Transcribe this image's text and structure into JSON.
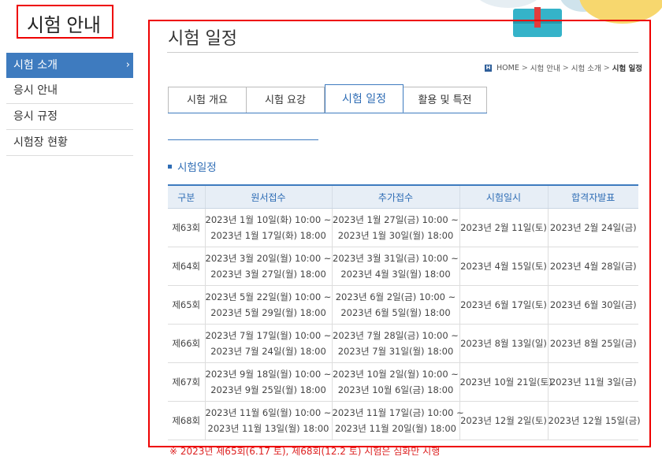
{
  "sidebar": {
    "title": "시험 안내",
    "items": [
      {
        "label": "시험 소개",
        "chevron": "›"
      },
      {
        "label": "응시 안내"
      },
      {
        "label": "응시 규정"
      },
      {
        "label": "시험장 현황"
      }
    ]
  },
  "page": {
    "title": "시험 일정",
    "breadcrumb": {
      "home_icon": "H",
      "items": [
        "HOME",
        "시험 안내",
        "시험 소개"
      ],
      "separator": ">",
      "current": "시험 일정"
    }
  },
  "tabs": [
    {
      "label": "시험 개요"
    },
    {
      "label": "시험 요강"
    },
    {
      "label": "시험 일정"
    },
    {
      "label": "활용 및 특전"
    }
  ],
  "section": {
    "title": "시험일정"
  },
  "schedule": {
    "headers": [
      "구분",
      "원서접수",
      "추가접수",
      "시험일시",
      "합격자발표"
    ],
    "rows": [
      {
        "round": "제63회",
        "apply": [
          "2023년 1월 10일(화) 10:00 ~",
          "2023년 1월 17일(화) 18:00"
        ],
        "extra": [
          "2023년 1월 27일(금) 10:00 ~",
          "2023년 1월 30일(월) 18:00"
        ],
        "exam": "2023년 2월 11일(토)",
        "result": "2023년 2월 24일(금)"
      },
      {
        "round": "제64회",
        "apply": [
          "2023년 3월 20일(월) 10:00 ~",
          "2023년 3월 27일(월) 18:00"
        ],
        "extra": [
          "2023년 3월 31일(금) 10:00 ~",
          "2023년 4월 3일(월) 18:00"
        ],
        "exam": "2023년 4월 15일(토)",
        "result": "2023년 4월 28일(금)"
      },
      {
        "round": "제65회",
        "apply": [
          "2023년 5월 22일(월) 10:00 ~",
          "2023년 5월 29일(월) 18:00"
        ],
        "extra": [
          "2023년 6월 2일(금) 10:00 ~",
          "2023년 6월 5일(월) 18:00"
        ],
        "exam": "2023년 6월 17일(토)",
        "result": "2023년 6월 30일(금)"
      },
      {
        "round": "제66회",
        "apply": [
          "2023년 7월 17일(월) 10:00 ~",
          "2023년 7월 24일(월) 18:00"
        ],
        "extra": [
          "2023년 7월 28일(금) 10:00 ~",
          "2023년 7월 31일(월) 18:00"
        ],
        "exam": "2023년 8월 13일(일)",
        "result": "2023년 8월 25일(금)"
      },
      {
        "round": "제67회",
        "apply": [
          "2023년 9월 18일(월) 10:00 ~",
          "2023년 9월 25일(월) 18:00"
        ],
        "extra": [
          "2023년 10월 2일(월) 10:00 ~",
          "2023년 10월 6일(금) 18:00"
        ],
        "exam": "2023년 10월 21일(토)",
        "result": "2023년 11월 3일(금)"
      },
      {
        "round": "제68회",
        "apply": [
          "2023년 11월 6일(월) 10:00 ~",
          "2023년 11월 13일(월) 18:00"
        ],
        "extra": [
          "2023년 11월 17일(금) 10:00 ~",
          "2023년 11월 20일(월) 18:00"
        ],
        "exam": "2023년 12월 2일(토)",
        "result": "2023년 12월 15일(금)"
      }
    ]
  },
  "footnote": "※ 2023년 제65회(6.17 토), 제68회(12.2 토) 시험은 심화만 시행",
  "colors": {
    "accent": "#3e7bbf",
    "highlight_border": "#ee0000",
    "footnote": "#dd2222"
  }
}
